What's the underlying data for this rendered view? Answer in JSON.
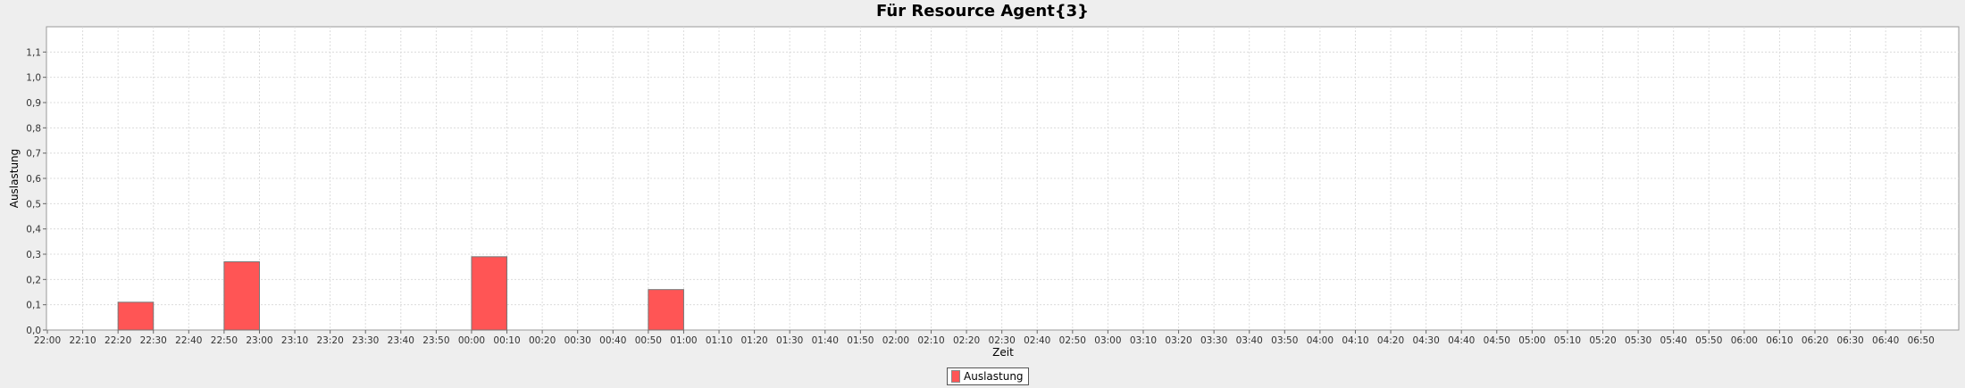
{
  "chart_data": {
    "type": "bar",
    "title": "Für Resource Agent{3}",
    "xlabel": "Zeit",
    "ylabel": "Auslastung",
    "ylim": [
      0,
      1.2
    ],
    "yticks": [
      "0,0",
      "0,1",
      "0,2",
      "0,3",
      "0,4",
      "0,5",
      "0,6",
      "0,7",
      "0,8",
      "0,9",
      "1,0",
      "1,1"
    ],
    "xticks": [
      "22:00",
      "22:10",
      "22:20",
      "22:30",
      "22:40",
      "22:50",
      "23:00",
      "23:10",
      "23:20",
      "23:30",
      "23:40",
      "23:50",
      "00:00",
      "00:10",
      "00:20",
      "00:30",
      "00:40",
      "00:50",
      "01:00",
      "01:10",
      "01:20",
      "01:30",
      "01:40",
      "01:50",
      "02:00",
      "02:10",
      "02:20",
      "02:30",
      "02:40",
      "02:50",
      "03:00",
      "03:10",
      "03:20",
      "03:30",
      "03:40",
      "03:50",
      "04:00",
      "04:10",
      "04:20",
      "04:30",
      "04:40",
      "04:50",
      "05:00",
      "05:10",
      "05:20",
      "05:30",
      "05:40",
      "05:50",
      "06:00",
      "06:10",
      "06:20",
      "06:30",
      "06:40",
      "06:50"
    ],
    "x_range": [
      "22:00",
      "07:00"
    ],
    "grid": true,
    "legend_position": "bottom",
    "series": [
      {
        "name": "Auslastung",
        "color": "#ff5555",
        "bars": [
          {
            "start": "22:20",
            "end": "22:30",
            "value": 0.11
          },
          {
            "start": "22:50",
            "end": "23:00",
            "value": 0.27
          },
          {
            "start": "00:00",
            "end": "00:10",
            "value": 0.29
          },
          {
            "start": "00:50",
            "end": "01:00",
            "value": 0.16
          }
        ]
      }
    ]
  }
}
